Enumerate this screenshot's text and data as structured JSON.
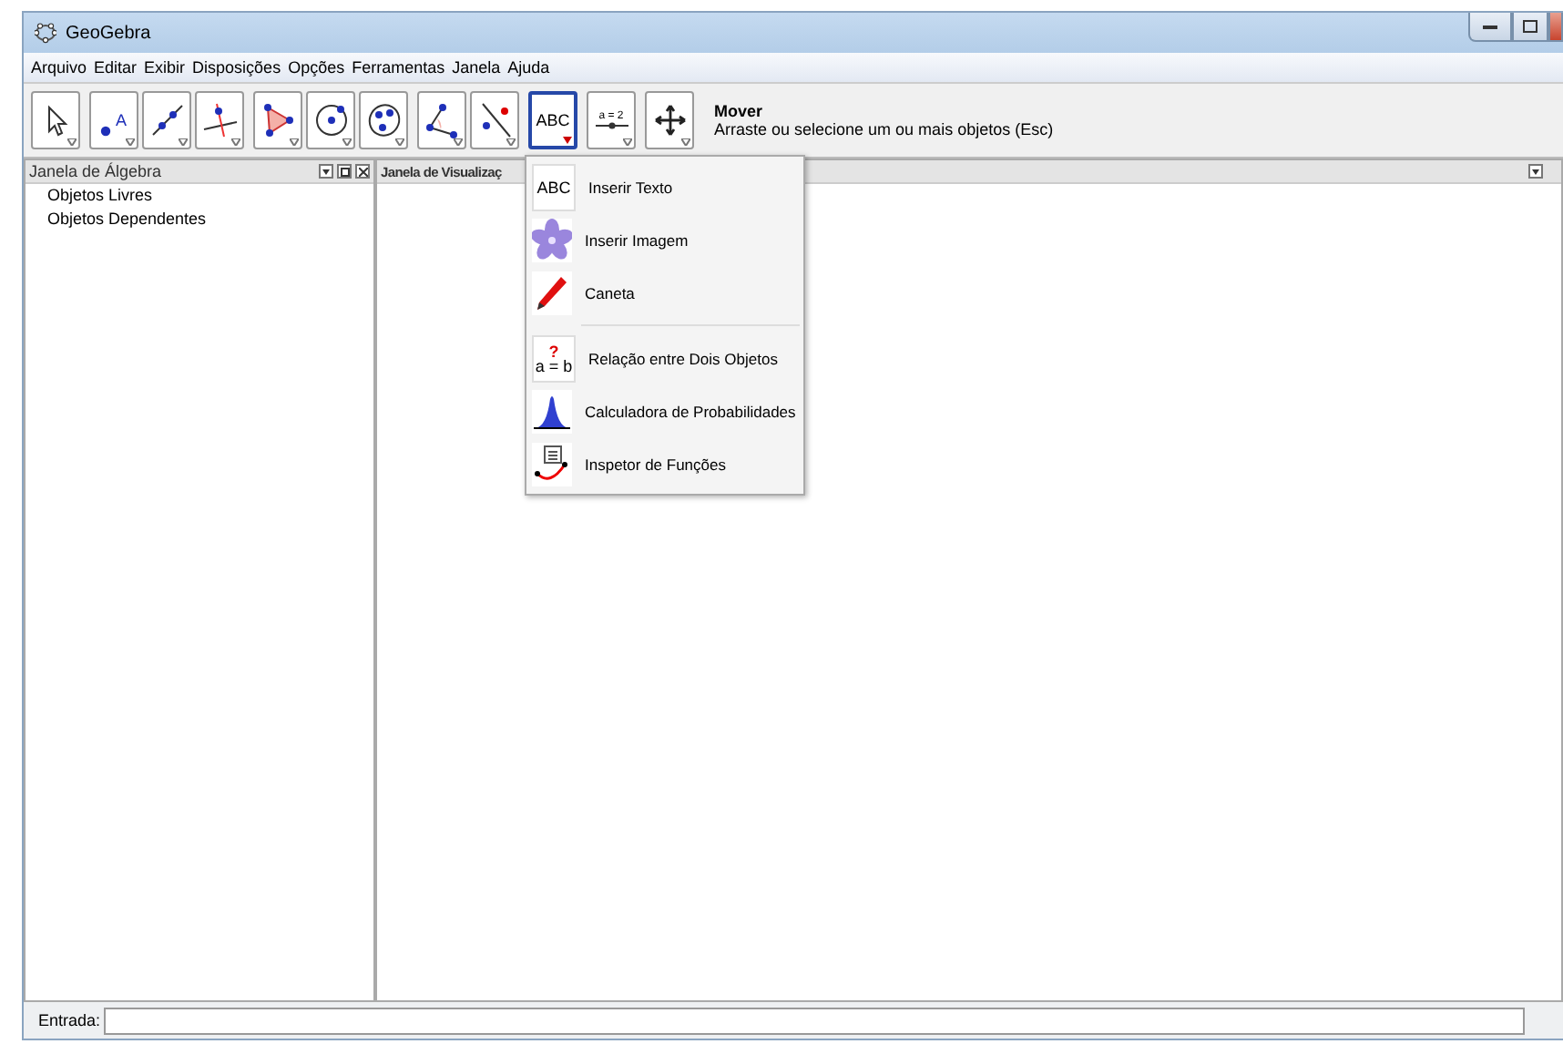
{
  "window": {
    "title": "GeoGebra"
  },
  "menu": [
    "Arquivo",
    "Editar",
    "Exibir",
    "Disposições",
    "Opções",
    "Ferramentas",
    "Janela",
    "Ajuda"
  ],
  "toolbar": {
    "groups": [
      [
        {
          "kind": "move",
          "selected": false
        }
      ],
      [
        {
          "kind": "point",
          "text": "A",
          "selected": false
        },
        {
          "kind": "line",
          "selected": false
        },
        {
          "kind": "perpendicular",
          "selected": false
        }
      ],
      [
        {
          "kind": "polygon",
          "selected": false
        },
        {
          "kind": "circle",
          "selected": false
        },
        {
          "kind": "ellipse",
          "selected": false
        }
      ],
      [
        {
          "kind": "angle",
          "selected": false
        },
        {
          "kind": "reflect",
          "selected": false
        }
      ],
      [
        {
          "kind": "text",
          "text": "ABC",
          "selected": true
        }
      ],
      [
        {
          "kind": "slider",
          "text": "a = 2",
          "selected": false
        }
      ],
      [
        {
          "kind": "pan",
          "selected": false
        }
      ]
    ],
    "help": {
      "title": "Mover",
      "description": "Arraste ou selecione um ou mais objetos (Esc)"
    }
  },
  "algebra": {
    "title": "Janela de Álgebra",
    "items": [
      "Objetos Livres",
      "Objetos Dependentes"
    ]
  },
  "graphics": {
    "title": "Janela de Visualizaç"
  },
  "dropdown": {
    "groups": [
      [
        {
          "kind": "text",
          "icon_text": "ABC",
          "label": "Inserir Texto"
        },
        {
          "kind": "image",
          "label": "Inserir Imagem"
        },
        {
          "kind": "pen",
          "label": "Caneta"
        }
      ],
      [
        {
          "kind": "relation",
          "icon_text": "?",
          "icon_text_2": "a = b",
          "label": "Relação entre Dois Objetos"
        },
        {
          "kind": "probability",
          "label": "Calculadora de Probabilidades"
        },
        {
          "kind": "inspector",
          "label": "Inspetor de Funções"
        }
      ]
    ]
  },
  "input_bar": {
    "label": "Entrada:"
  }
}
